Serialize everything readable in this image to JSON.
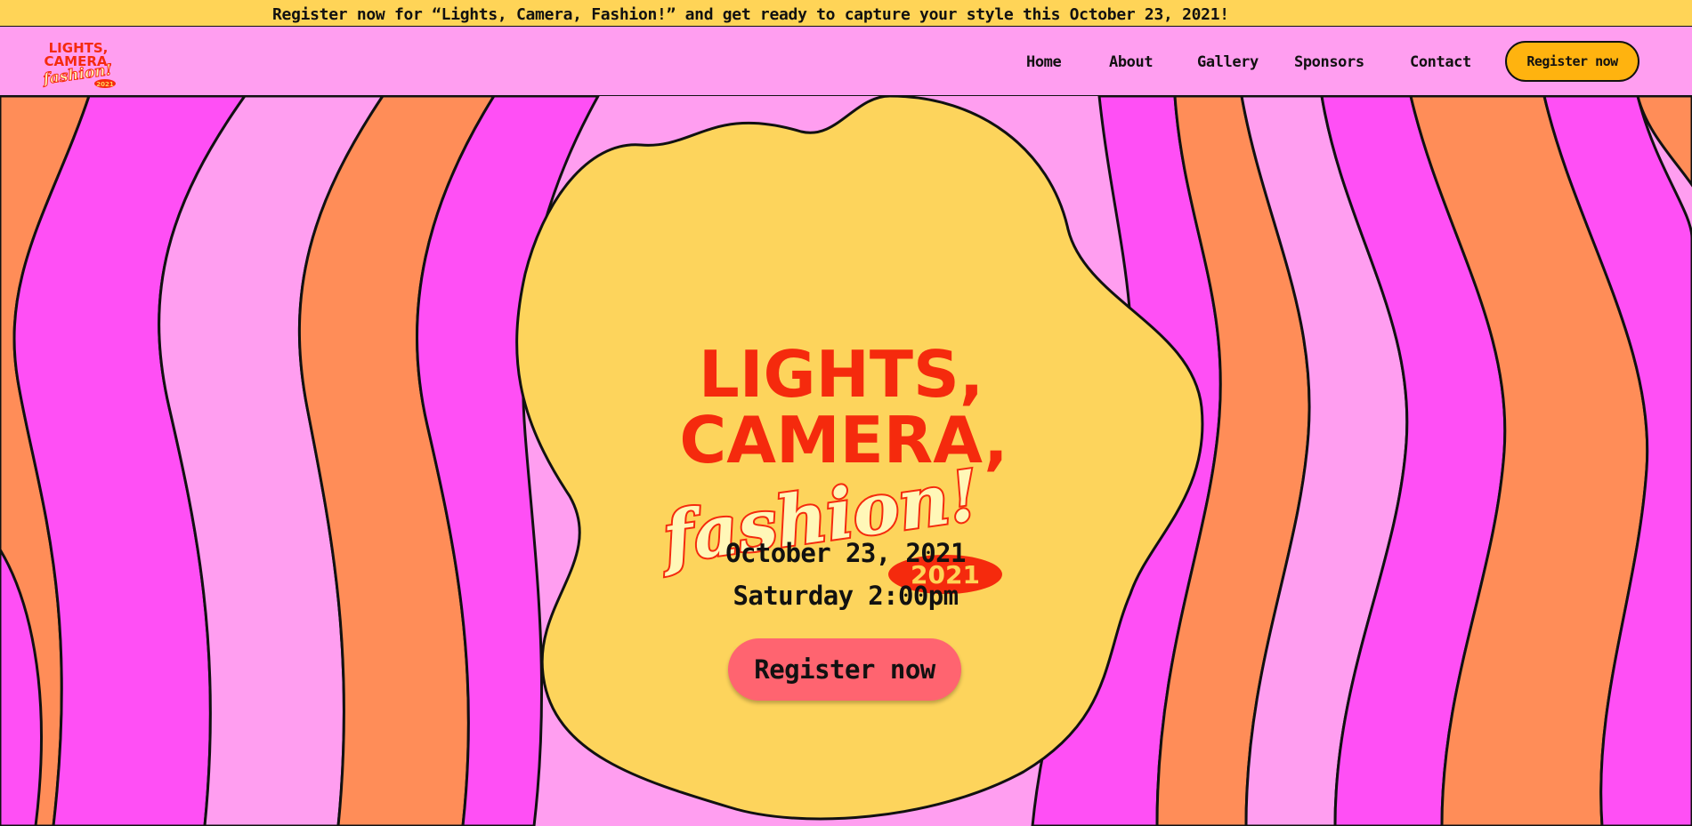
{
  "banner": {
    "text": "Register now for “Lights, Camera, Fashion!” and get ready to capture your style this October 23, 2021!"
  },
  "logo": {
    "line1": "LIGHTS,",
    "line2": "CAMERA,",
    "script": "fashion!",
    "year": "2021"
  },
  "nav": {
    "items": [
      {
        "label": "Home"
      },
      {
        "label": "About"
      },
      {
        "label": "Gallery"
      },
      {
        "label": "Sponsors"
      },
      {
        "label": "Contact"
      }
    ],
    "cta_label": "Register now"
  },
  "hero": {
    "title_line1": "LIGHTS,",
    "title_line2": "CAMERA,",
    "title_script": "fashion!",
    "title_year": "2021",
    "date": "October 23, 2021",
    "time": "Saturday 2:00pm",
    "cta_label": "Register now"
  },
  "colors": {
    "banner_bg": "#ffd457",
    "nav_bg": "#ff9ef0",
    "stripe_magenta": "#ff4ff5",
    "stripe_pink": "#ff9ef0",
    "stripe_orange": "#ff8d58",
    "blob_yellow": "#fdd45c",
    "title_red": "#f52a0d",
    "script_cream": "#fff7b8",
    "cta_coral": "#ff6470",
    "nav_cta_orange": "#ffb30f"
  },
  "icons": {
    "logo": "lights-camera-fashion-logo"
  }
}
